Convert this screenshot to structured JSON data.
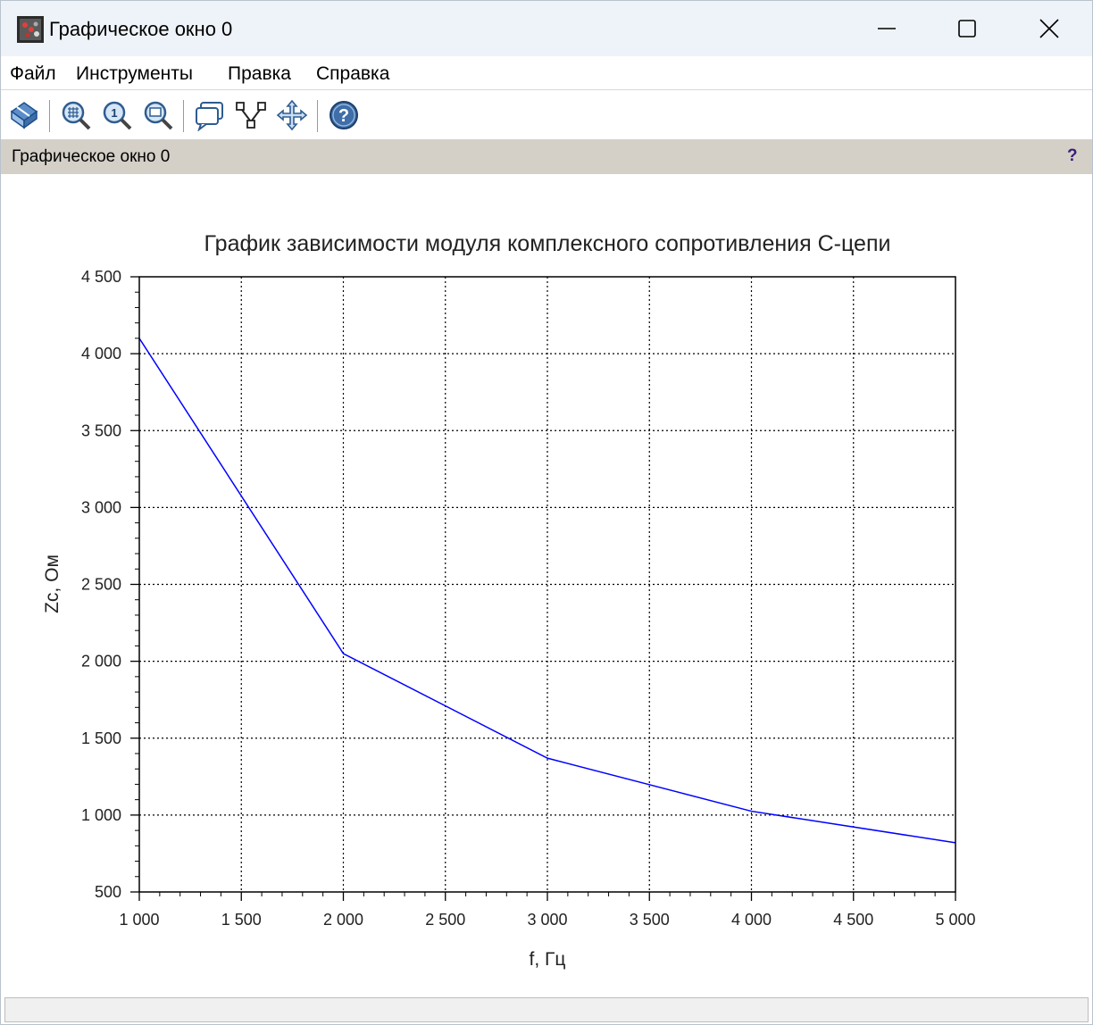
{
  "window": {
    "title": "Графическое окно 0",
    "icon": "scilab-graphic-icon"
  },
  "menu": {
    "items": [
      "Файл",
      "Инструменты",
      "Правка",
      "Справка"
    ]
  },
  "toolbar": {
    "buttons": [
      "rotate-3d-icon",
      "zoom-icon",
      "zoom-reset-icon",
      "data-tip-icon",
      "datatip-manager-icon",
      "edit-data-icon",
      "pan-icon",
      "help-icon"
    ]
  },
  "panel": {
    "title": "Графическое окно 0",
    "help": "?"
  },
  "colors": {
    "line": "#0000ff",
    "panel": "#d4d0c8",
    "titlebar": "#eef3f9"
  },
  "chart_data": {
    "type": "line",
    "title": "График зависимости модуля комплексного сопротивления С-цепи",
    "xlabel": "f, Гц",
    "ylabel": "Zc, Ом",
    "xlim": [
      1000,
      5000
    ],
    "ylim": [
      500,
      4500
    ],
    "xticks": [
      1000,
      1500,
      2000,
      2500,
      3000,
      3500,
      4000,
      4500,
      5000
    ],
    "yticks": [
      500,
      1000,
      1500,
      2000,
      2500,
      3000,
      3500,
      4000,
      4500
    ],
    "xtick_labels": [
      "1 000",
      "1 500",
      "2 000",
      "2 500",
      "3 000",
      "3 500",
      "4 000",
      "4 500",
      "5 000"
    ],
    "ytick_labels": [
      "500",
      "1 000",
      "1 500",
      "2 000",
      "2 500",
      "3 000",
      "3 500",
      "4 000",
      "4 500"
    ],
    "grid": true,
    "series": [
      {
        "x": [
          1000,
          2000,
          3000,
          4000,
          5000
        ],
        "y": [
          4100,
          2050,
          1370,
          1025,
          820
        ],
        "color": "#0000ff"
      }
    ]
  }
}
